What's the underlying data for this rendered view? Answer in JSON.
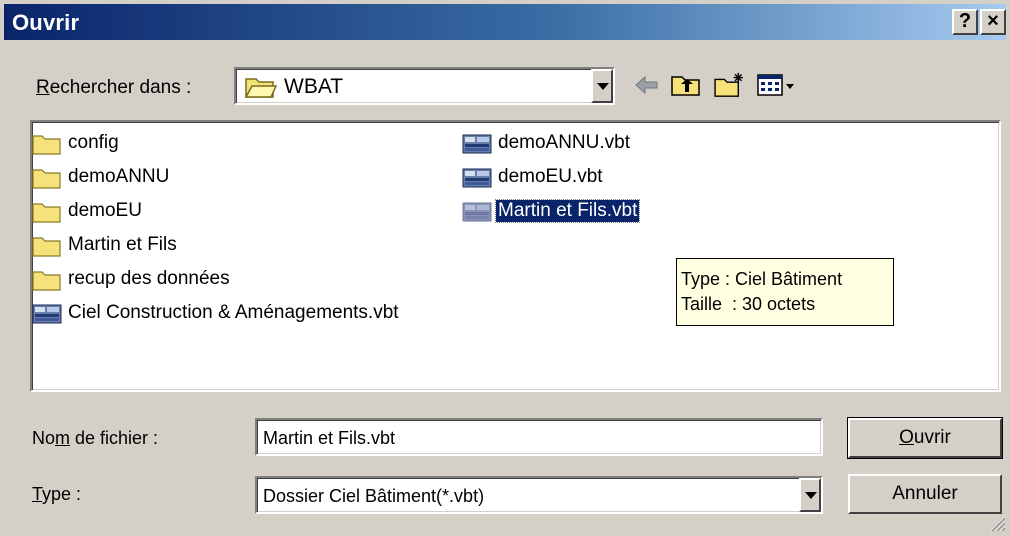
{
  "window": {
    "title": "Ouvrir",
    "help_label": "?",
    "close_label": "×"
  },
  "lookin": {
    "label_mnemonic": "R",
    "label_rest": "echercher dans :",
    "value": "WBAT"
  },
  "files": {
    "column1": [
      {
        "name": "config",
        "icon": "folder-icon"
      },
      {
        "name": "demoANNU",
        "icon": "folder-icon"
      },
      {
        "name": "demoEU",
        "icon": "folder-icon"
      },
      {
        "name": "Martin et Fils",
        "icon": "folder-icon"
      },
      {
        "name": "recup des données",
        "icon": "folder-icon"
      },
      {
        "name": "Ciel Construction & Aménagements.vbt",
        "icon": "vbt-file-icon"
      }
    ],
    "column2": [
      {
        "name": "demoANNU.vbt",
        "icon": "vbt-file-icon"
      },
      {
        "name": "demoEU.vbt",
        "icon": "vbt-file-icon"
      },
      {
        "name": "Martin et Fils.vbt",
        "icon": "vbt-file-icon",
        "selected": true
      }
    ]
  },
  "tooltip": {
    "line1": "Type : Ciel Bâtiment",
    "line2": "Taille  : 30 octets"
  },
  "filename": {
    "label_pre": "No",
    "label_mnemonic": "m",
    "label_post": " de fichier :",
    "value": "Martin et Fils.vbt"
  },
  "filetype": {
    "label_mnemonic": "T",
    "label_post": "ype :",
    "value": "Dossier Ciel Bâtiment(*.vbt)"
  },
  "buttons": {
    "open_mnemonic": "O",
    "open_rest": "uvrir",
    "cancel": "Annuler"
  },
  "colors": {
    "face": "#d4d0c8",
    "title_start": "#0a246a",
    "title_end": "#a6caf0",
    "selection": "#0a246a",
    "tooltip": "#ffffe1"
  }
}
